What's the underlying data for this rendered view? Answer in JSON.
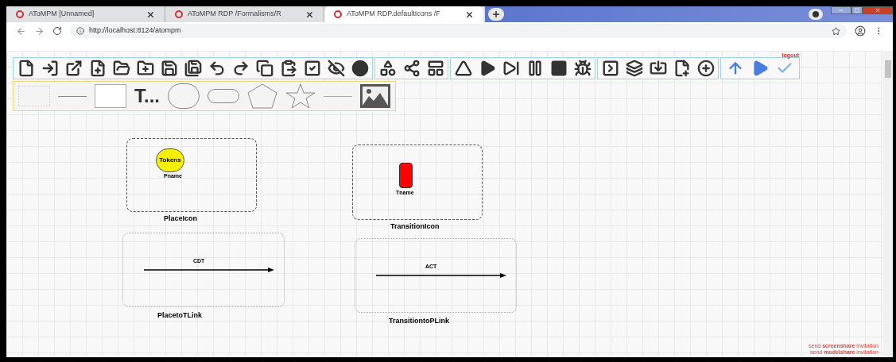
{
  "browser": {
    "tabs": [
      {
        "title": "AToMPM   [Unnamed]",
        "selected": false
      },
      {
        "title": "AToMPM   RDP   /Formalisms/R",
        "selected": false
      },
      {
        "title": "AToMPM   RDP.defaultIcons   /F",
        "selected": true
      }
    ],
    "url": "http://localhost:8124/atompm"
  },
  "toolbar": {
    "logout": "logout",
    "shape_palette": {
      "text_tool": "T..."
    }
  },
  "canvas": {
    "items": [
      {
        "kind": "place",
        "name": "PlaceIcon",
        "inner_label": "Tokens",
        "sub_label": "Pname"
      },
      {
        "kind": "transition",
        "name": "TransitionIcon",
        "sub_label": "Tname"
      },
      {
        "kind": "link",
        "name": "PlacetoTLink",
        "sub_label": "CDT"
      },
      {
        "kind": "link",
        "name": "TransitiontoPLink",
        "sub_label": "ACT"
      }
    ]
  },
  "footer": {
    "links": [
      "send **screenshare** invitation",
      "send **modelshare** invitation"
    ]
  }
}
